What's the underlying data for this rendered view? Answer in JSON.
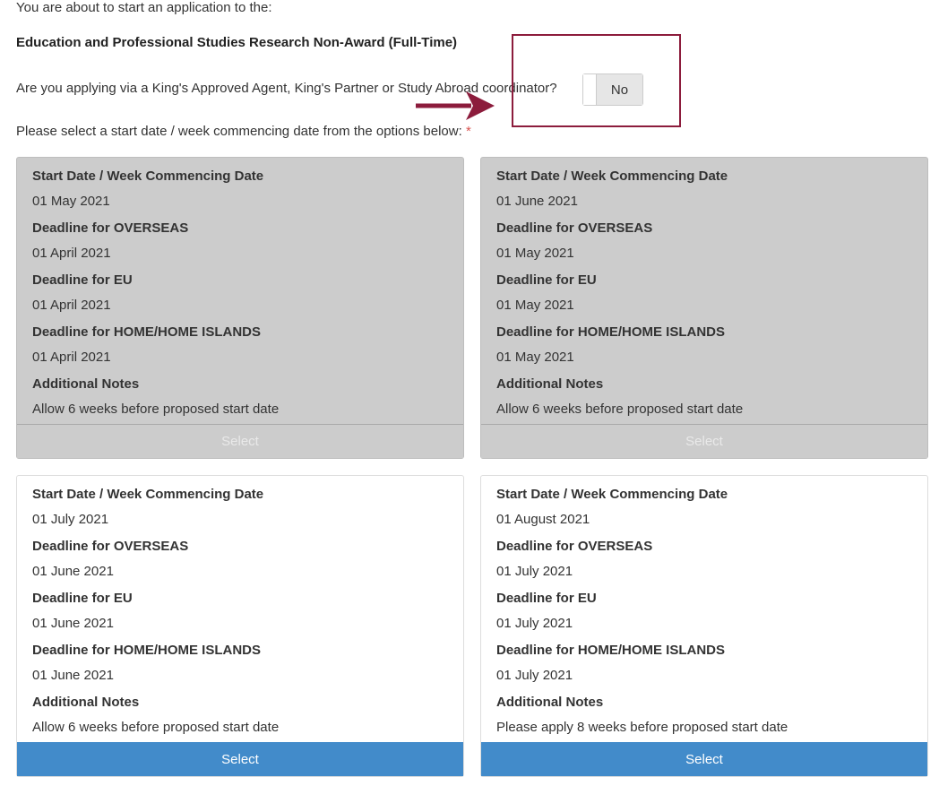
{
  "header": {
    "intro": "You are about to start an application to the:",
    "programme": "Education and Professional Studies Research Non-Award (Full-Time)"
  },
  "agent": {
    "question": "Are you applying via a King's Approved Agent, King's Partner or Study Abroad coordinator?",
    "toggle_value": "No"
  },
  "start_prompt": {
    "text": "Please select a start date / week commencing date from the options below:",
    "required_marker": "*"
  },
  "labels": {
    "start": "Start Date / Week Commencing Date",
    "overseas": "Deadline for OVERSEAS",
    "eu": "Deadline for EU",
    "home": "Deadline for HOME/HOME ISLANDS",
    "notes": "Additional Notes"
  },
  "cards": [
    {
      "start": "01 May 2021",
      "overseas": "01 April 2021",
      "eu": "01 April 2021",
      "home": "01 April 2021",
      "notes": "Allow 6 weeks before proposed start date",
      "button": "Select",
      "enabled": false
    },
    {
      "start": "01 June 2021",
      "overseas": "01 May 2021",
      "eu": "01 May 2021",
      "home": "01 May 2021",
      "notes": "Allow 6 weeks before proposed start date",
      "button": "Select",
      "enabled": false
    },
    {
      "start": "01 July 2021",
      "overseas": "01 June 2021",
      "eu": "01 June 2021",
      "home": "01 June 2021",
      "notes": "Allow 6 weeks before proposed start date",
      "button": "Select",
      "enabled": true
    },
    {
      "start": "01 August 2021",
      "overseas": "01 July 2021",
      "eu": "01 July 2021",
      "home": "01 July 2021",
      "notes": "Please apply 8 weeks before proposed start date",
      "button": "Select",
      "enabled": true
    }
  ],
  "colors": {
    "annotation": "#8c1c3c",
    "primary_button": "#428bca",
    "disabled_card": "#cccccc",
    "required": "#d9534f"
  }
}
